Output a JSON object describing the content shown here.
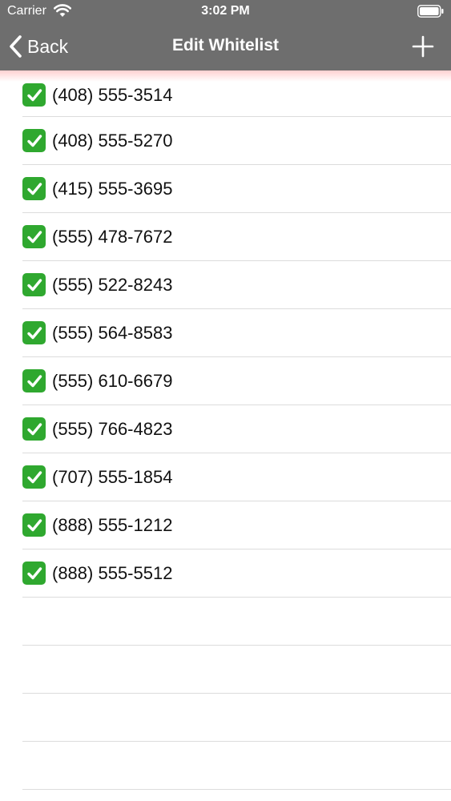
{
  "status_bar": {
    "carrier": "Carrier",
    "time": "3:02 PM",
    "wifi_icon": "wifi-icon",
    "battery_icon": "battery-icon"
  },
  "nav_bar": {
    "back_label": "Back",
    "back_icon": "chevron-left-icon",
    "title": "Edit Whitelist",
    "add_icon": "plus-icon",
    "background_color": "#6e6e6e"
  },
  "whitelist": {
    "check_icon": "checkmark-box-icon",
    "check_color": "#2fa82f",
    "items": [
      {
        "number": "(408) 555-3514",
        "checked": true
      },
      {
        "number": "(408) 555-5270",
        "checked": true
      },
      {
        "number": "(415) 555-3695",
        "checked": true
      },
      {
        "number": "(555) 478-7672",
        "checked": true
      },
      {
        "number": "(555) 522-8243",
        "checked": true
      },
      {
        "number": "(555) 564-8583",
        "checked": true
      },
      {
        "number": "(555) 610-6679",
        "checked": true
      },
      {
        "number": "(555) 766-4823",
        "checked": true
      },
      {
        "number": "(707) 555-1854",
        "checked": true
      },
      {
        "number": "(888) 555-1212",
        "checked": true
      },
      {
        "number": "(888) 555-5512",
        "checked": true
      }
    ]
  }
}
